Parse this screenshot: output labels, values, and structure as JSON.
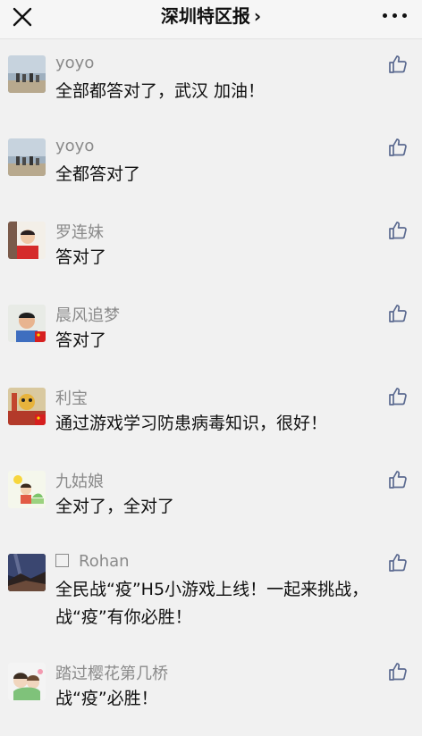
{
  "header": {
    "title": "深圳特区报",
    "title_chevron": "›",
    "close_icon": "close-icon",
    "more_icon": "more-icon"
  },
  "comments": [
    {
      "name": "yoyo",
      "text": "全部都答对了，武汉 加油！"
    },
    {
      "name": "yoyo",
      "text": "全都答对了"
    },
    {
      "name": "罗连妹",
      "text": "答对了"
    },
    {
      "name": "晨风追梦",
      "text": "答对了"
    },
    {
      "name": "利宝",
      "text": "通过游戏学习防患病毒知识，很好！"
    },
    {
      "name": "九姑娘",
      "text": "全对了，全对了"
    },
    {
      "name": "Rohan",
      "text": "全民战“疫”H5小游戏上线！一起来挑战，战“疫”有你必胜！"
    },
    {
      "name": "踏过樱花第几桥",
      "text": "战“疫”必胜！"
    }
  ],
  "colors": {
    "background": "#f1f1f1",
    "name": "#8a8a8a",
    "text": "#111111",
    "icon": "#5b6a90"
  }
}
